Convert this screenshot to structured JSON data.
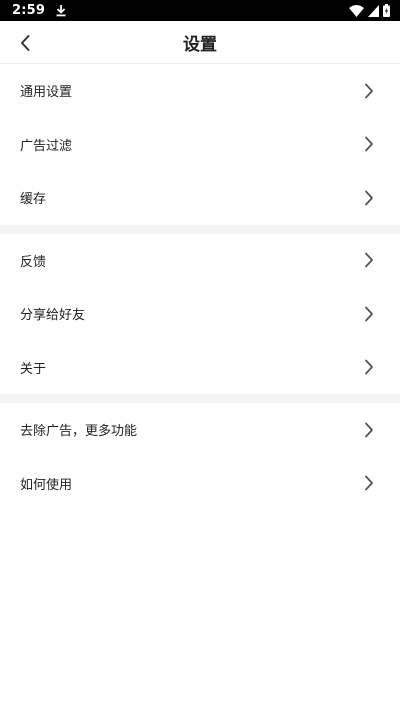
{
  "status_bar": {
    "time": "2:59",
    "icons": [
      "download-icon",
      "wifi-icon",
      "signal-icon",
      "battery-icon"
    ]
  },
  "header": {
    "title": "设置",
    "back_icon": "chevron-left-icon"
  },
  "groups": [
    {
      "items": [
        {
          "label": "通用设置"
        },
        {
          "label": "广告过滤"
        },
        {
          "label": "缓存"
        }
      ]
    },
    {
      "items": [
        {
          "label": "反馈"
        },
        {
          "label": "分享给好友"
        },
        {
          "label": "关于"
        }
      ]
    },
    {
      "items": [
        {
          "label": "去除广告，更多功能"
        },
        {
          "label": "如何使用"
        }
      ]
    }
  ],
  "colors": {
    "status_bar_bg": "#000000",
    "text": "#222222",
    "chevron": "#555555",
    "separator_bg": "#f4f4f4"
  }
}
